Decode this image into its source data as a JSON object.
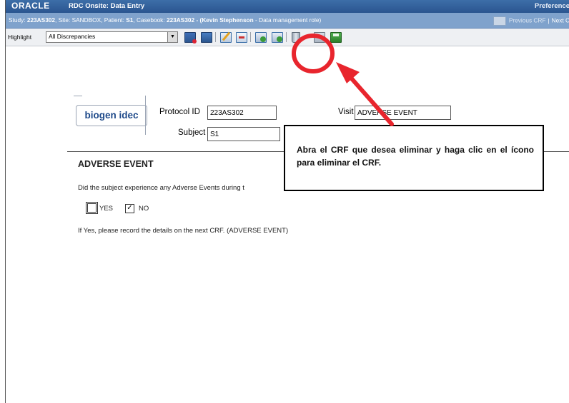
{
  "app": {
    "logo": "ORACLE",
    "title": "RDC Onsite: Data Entry",
    "preferences": "Preference"
  },
  "study_bar": {
    "prefix": "Study: ",
    "study": "223AS302",
    "site_label": ", Site: SANDBOX, Patient: ",
    "patient": "S1",
    "casebook_label": ", Casebook: ",
    "casebook": "223AS302",
    "user": "- (Kevin Stephenson",
    "role": " - Data management role)",
    "previous_crf": "Previous CRF",
    "next_crf": "Next C"
  },
  "toolbar": {
    "highlight_label": "Highlight",
    "highlight_value": "All Discrepancies"
  },
  "form": {
    "logo_text": "biogen idec",
    "protocol_label": "Protocol ID",
    "protocol_value": "223AS302",
    "visit_label": "Visit",
    "visit_value": "ADVERSE EVENT",
    "subject_label": "Subject",
    "subject_value": "S1",
    "section_title": "ADVERSE EVENT",
    "question": "Did the subject experience any Adverse Events during t",
    "yes_label": "YES",
    "no_label": "NO",
    "no_checked": "✓",
    "note": "If Yes, please record the details on the next CRF. (ADVERSE EVENT)"
  },
  "callout": {
    "text": "Abra el CRF que desea eliminar y haga clic en el ícono para eliminar el CRF."
  },
  "colors": {
    "titlebar": "#2a5590",
    "studybar": "#7fa2cc",
    "annotation_red": "#e8252d",
    "logo_blue": "#1f4a8a"
  }
}
